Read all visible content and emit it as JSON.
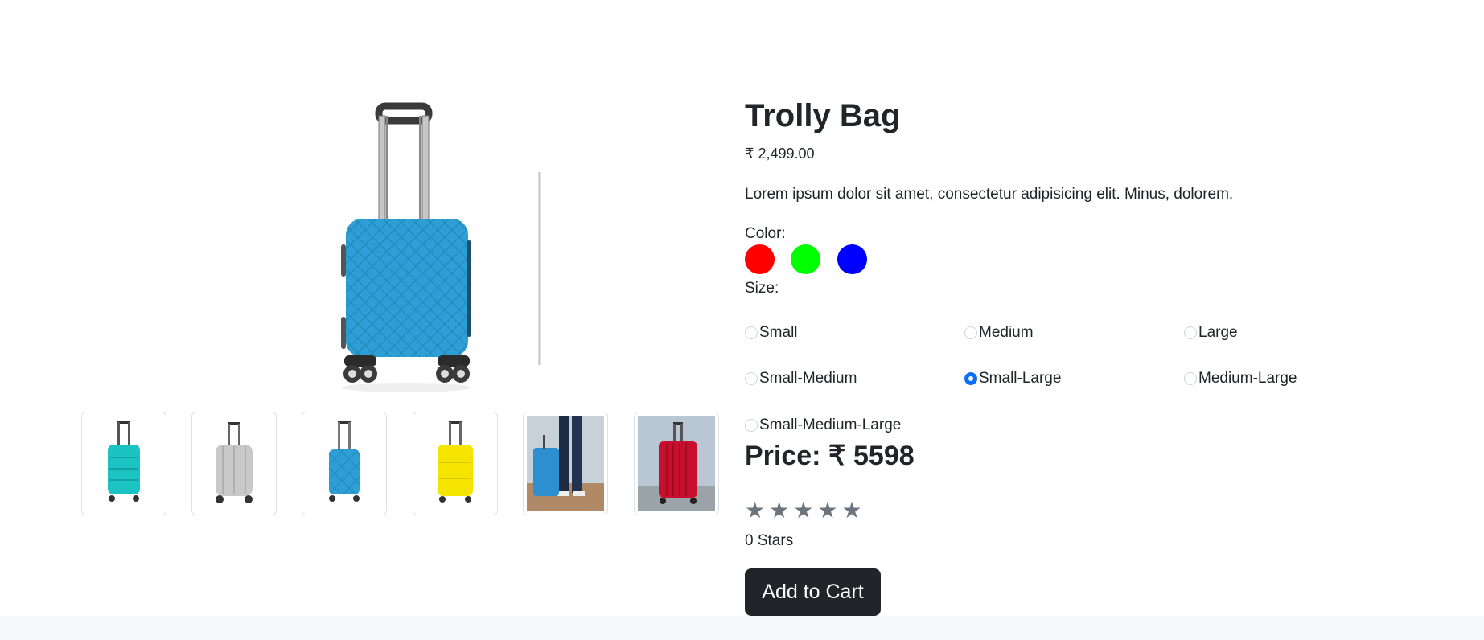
{
  "product": {
    "title": "Trolly Bag",
    "list_price": "₹ 2,499.00",
    "description": "Lorem ipsum dolor sit amet, consectetur adipisicing elit. Minus, dolorem."
  },
  "color": {
    "label": "Color:",
    "options": [
      "#ff0000",
      "#00ff00",
      "#0000ff"
    ]
  },
  "size": {
    "label": "Size:",
    "options": [
      {
        "label": "Small",
        "checked": false
      },
      {
        "label": "Medium",
        "checked": false
      },
      {
        "label": "Large",
        "checked": false
      },
      {
        "label": "Small-Medium",
        "checked": false
      },
      {
        "label": "Small-Large",
        "checked": true
      },
      {
        "label": "Medium-Large",
        "checked": false
      },
      {
        "label": "Small-Medium-Large",
        "checked": false
      }
    ]
  },
  "price": {
    "total": "Price: ₹ 5598"
  },
  "rating": {
    "stars": [
      "★",
      "★",
      "★",
      "★",
      "★"
    ],
    "value": 0,
    "count_label": "0 Stars"
  },
  "cart": {
    "button_label": "Add to Cart"
  },
  "gallery": {
    "main_image": "blue-quilted-suitcase",
    "thumbnails": [
      "teal-suitcase",
      "silver-suitcase",
      "blue-quilted-suitcase",
      "yellow-suitcase",
      "person-with-blue-suitcase",
      "red-suitcase"
    ]
  },
  "colors": {
    "accent": "#0d6efd",
    "button": "#212529",
    "star": "#6c757d"
  }
}
